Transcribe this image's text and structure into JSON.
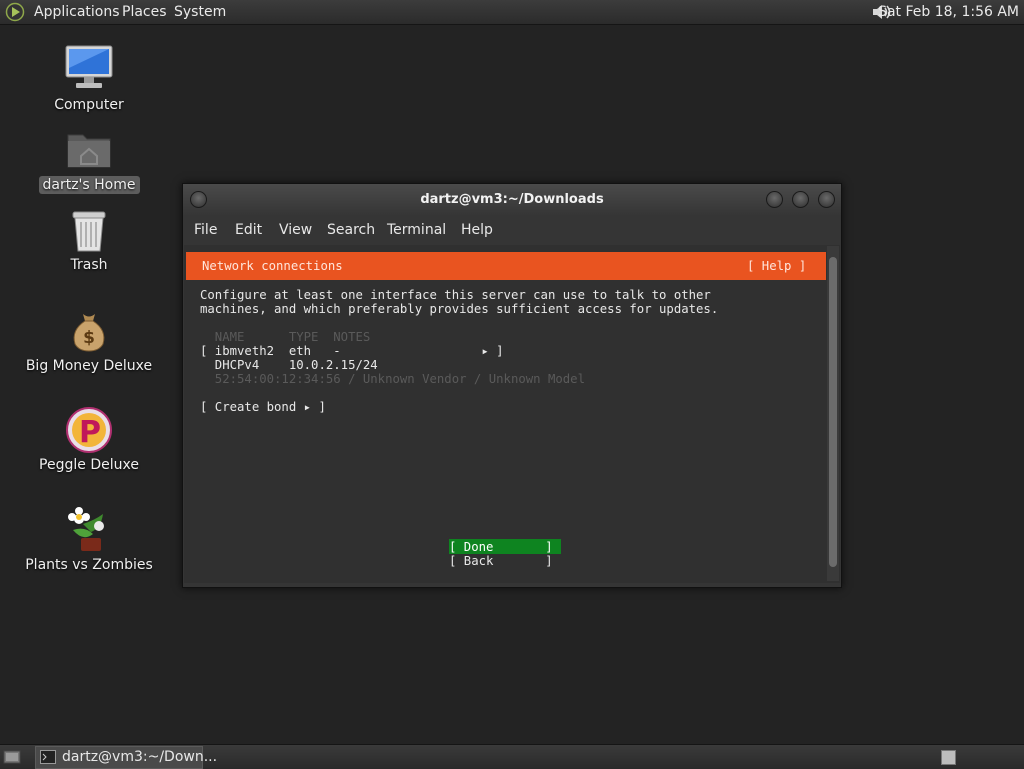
{
  "top_panel": {
    "menus": [
      "Applications",
      "Places",
      "System"
    ],
    "clock": "Sat Feb 18,  1:56 AM",
    "icons": {
      "menu": "distro-logo-icon",
      "volume": "volume-icon"
    }
  },
  "desktop": {
    "icons": [
      {
        "label": "Computer",
        "icon": "computer-icon"
      },
      {
        "label": "dartz's Home",
        "icon": "home-folder-icon"
      },
      {
        "label": "Trash",
        "icon": "trash-icon"
      },
      {
        "label": "Big Money Deluxe",
        "icon": "money-bag-icon"
      },
      {
        "label": "Peggle Deluxe",
        "icon": "peggle-icon"
      },
      {
        "label": "Plants vs Zombies",
        "icon": "plant-icon"
      }
    ]
  },
  "terminal": {
    "title": "dartz@vm3:~/Downloads",
    "menu": [
      "File",
      "Edit",
      "View",
      "Search",
      "Terminal",
      "Help"
    ],
    "banner_title": "Network connections",
    "banner_help": "[ Help ]",
    "intro_1": "Configure at least one interface this server can use to talk to other",
    "intro_2": "machines, and which preferably provides sufficient access for updates.",
    "table_header": "  NAME      TYPE  NOTES",
    "iface_row": "[ ibmveth2  eth   -                   ▸ ]",
    "iface_addr": "  DHCPv4    10.0.2.15/24",
    "iface_mac": "  52:54:00:12:34:56 / Unknown Vendor / Unknown Model",
    "create_bond": "[ Create bond ▸ ]",
    "done": "[ Done       ]",
    "back": "[ Back       ]"
  },
  "taskbar": {
    "task_label": "dartz@vm3:~/Down...",
    "icons": {
      "show_desktop": "show-desktop-icon",
      "task": "terminal-icon",
      "workspace": "workspace-switcher-icon"
    }
  },
  "colors": {
    "banner": "#e95420",
    "done_button": "#0e8420",
    "desktop_bg": "#232323"
  }
}
